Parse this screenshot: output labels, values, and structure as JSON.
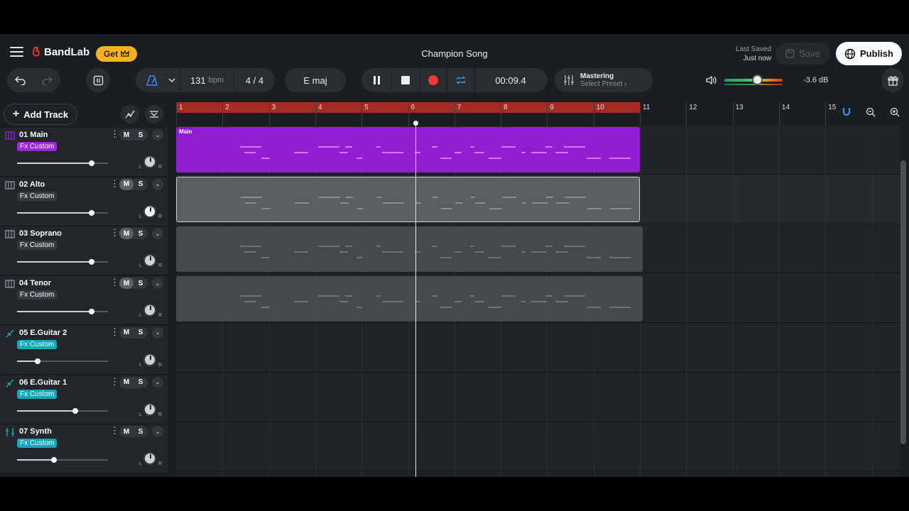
{
  "header": {
    "brand": "BandLab",
    "get_label": "Get",
    "song_title": "Champion Song",
    "last_saved_label": "Last Saved",
    "last_saved_value": "Just now",
    "save_label": "Save",
    "publish_label": "Publish"
  },
  "toolbar": {
    "bpm_value": "131",
    "bpm_unit": "bpm",
    "time_signature": "4 / 4",
    "key": "E maj",
    "time": "00:09.4",
    "mastering_label": "Mastering",
    "mastering_preset": "Select Preset",
    "volume_db": "-3.6 dB"
  },
  "sidebar": {
    "add_track_label": "Add Track"
  },
  "tracks": [
    {
      "name": "01  Main",
      "fx": "Fx Custom",
      "mute": "M",
      "solo": "S",
      "color": "#9a27d8",
      "fx_bg": "#9a27d8",
      "muted": false,
      "pan": 0.82
    },
    {
      "name": "02  Alto",
      "fx": "Fx Custom",
      "mute": "M",
      "solo": "S",
      "color": "#9aa0a6",
      "fx_bg": "#363a40",
      "muted": true,
      "pan": 0.82
    },
    {
      "name": "03  Soprano",
      "fx": "Fx Custom",
      "mute": "M",
      "solo": "S",
      "color": "#9aa0a6",
      "fx_bg": "#363a40",
      "muted": true,
      "pan": 0.82
    },
    {
      "name": "04  Tenor",
      "fx": "Fx Custom",
      "mute": "M",
      "solo": "S",
      "color": "#9aa0a6",
      "fx_bg": "#363a40",
      "muted": true,
      "pan": 0.82
    },
    {
      "name": "05  E.Guitar 2",
      "fx": "Fx Custom",
      "mute": "M",
      "solo": "S",
      "color": "#1bb3c4",
      "fx_bg": "#17a7b8",
      "muted": false,
      "pan": 0.23
    },
    {
      "name": "06  E.Guitar 1",
      "fx": "Fx Custom",
      "mute": "M",
      "solo": "S",
      "color": "#1bb3c4",
      "fx_bg": "#17a7b8",
      "muted": false,
      "pan": 0.64
    },
    {
      "name": "07  Synth",
      "fx": "Fx Custom",
      "mute": "M",
      "solo": "S",
      "color": "#1bb3c4",
      "fx_bg": "#17a7b8",
      "muted": false,
      "pan": 0.41
    }
  ],
  "pan_labels": {
    "left": "L",
    "right": "R"
  },
  "ruler": {
    "bars": [
      "1",
      "2",
      "3",
      "4",
      "5",
      "6",
      "7",
      "8",
      "9",
      "10",
      "11",
      "12",
      "13",
      "14",
      "15"
    ]
  },
  "clips": [
    {
      "name": "Main",
      "color": "#8f1fd0"
    }
  ],
  "colors": {
    "accent_purple": "#8f1fd0",
    "loop_region": "#a82a22",
    "record": "#ef3a2d",
    "get_button": "#f6b21a",
    "teal": "#17a7b8"
  }
}
